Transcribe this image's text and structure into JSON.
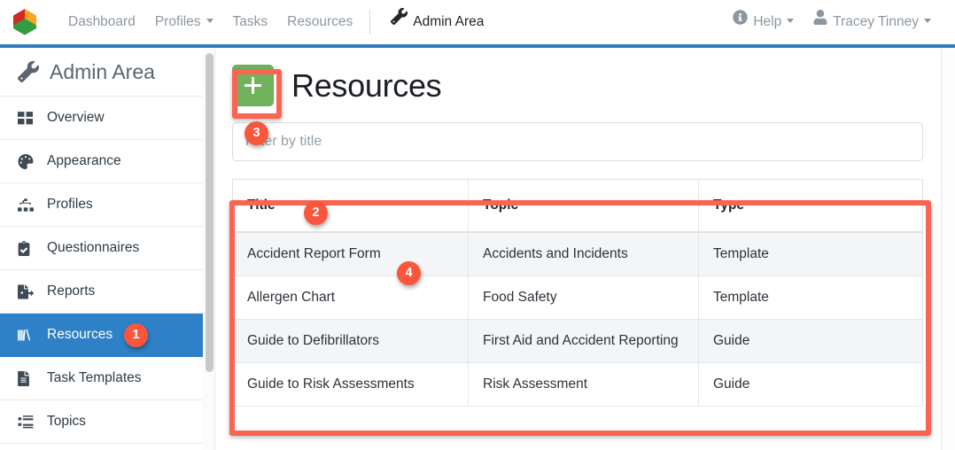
{
  "navbar": {
    "logo_icon": "cube-logo-icon",
    "links": [
      {
        "label": "Dashboard",
        "icon": null,
        "caret": false,
        "active": false
      },
      {
        "label": "Profiles",
        "icon": null,
        "caret": true,
        "active": false
      },
      {
        "label": "Tasks",
        "icon": null,
        "caret": false,
        "active": false
      },
      {
        "label": "Resources",
        "icon": null,
        "caret": false,
        "active": false
      }
    ],
    "admin_area": {
      "label": "Admin Area",
      "icon": "wrench-icon"
    },
    "help": {
      "label": "Help",
      "icon": "question-circle-icon",
      "caret": true
    },
    "user": {
      "label": "Tracey Tinney",
      "icon": "user-icon",
      "caret": true
    }
  },
  "sidebar": {
    "title": "Admin Area",
    "title_icon": "wrench-icon",
    "items": [
      {
        "label": "Overview",
        "icon": "th-large-icon",
        "active": false
      },
      {
        "label": "Appearance",
        "icon": "palette-icon",
        "active": false
      },
      {
        "label": "Profiles",
        "icon": "sitemap-icon",
        "active": false
      },
      {
        "label": "Questionnaires",
        "icon": "clipboard-check-icon",
        "active": false
      },
      {
        "label": "Reports",
        "icon": "file-export-icon",
        "active": false
      },
      {
        "label": "Resources",
        "icon": "books-icon",
        "active": true
      },
      {
        "label": "Task Templates",
        "icon": "file-alt-icon",
        "active": false
      },
      {
        "label": "Topics",
        "icon": "list-icon",
        "active": false
      }
    ]
  },
  "main": {
    "page_title": "Resources",
    "add_button": {
      "label": "+",
      "icon": "plus-icon",
      "color": "#71b35c"
    },
    "filter": {
      "value": "",
      "placeholder": "Filter by title"
    },
    "table": {
      "columns": [
        "Title",
        "Topic",
        "Type"
      ],
      "rows": [
        [
          "Accident Report Form",
          "Accidents and Incidents",
          "Template"
        ],
        [
          "Allergen Chart",
          "Food Safety",
          "Template"
        ],
        [
          "Guide to Defibrillators",
          "First Aid and Accident Reporting",
          "Guide"
        ],
        [
          "Guide to Risk Assessments",
          "Risk Assessment",
          "Guide"
        ]
      ]
    }
  },
  "annotations": {
    "highlight_color": "#fa6450",
    "badge_color": "#f9563c",
    "badges": [
      {
        "number": "1",
        "target": "sidebar-item-resources"
      },
      {
        "number": "2",
        "target": "resources-table"
      },
      {
        "number": "3",
        "target": "add-resource-button"
      },
      {
        "number": "4",
        "target": "table-row-accident-report-form"
      }
    ]
  },
  "colors": {
    "accent_blue": "#2e81c6",
    "rule_blue": "#2f7dbd",
    "green": "#71b35c"
  }
}
